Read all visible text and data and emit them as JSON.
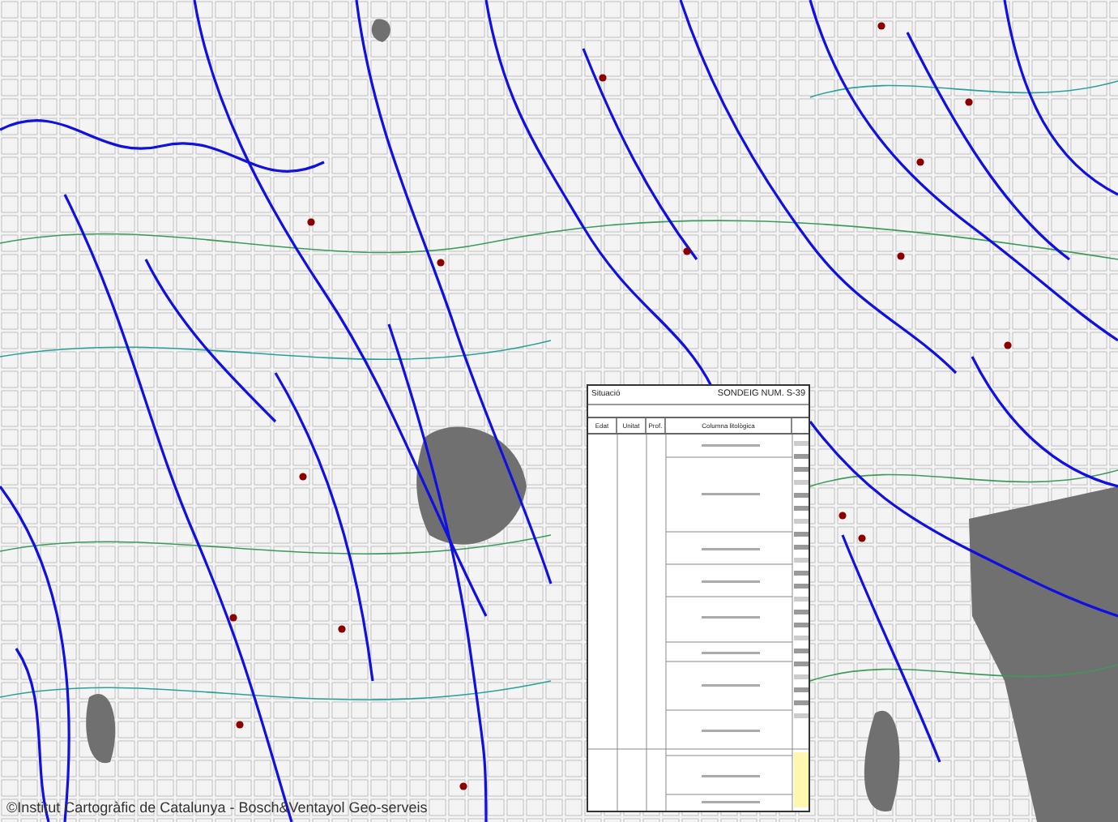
{
  "map": {
    "attribution": "©Institut Cartogràfic de Catalunya - Bosch&Ventayol Geo-serveis"
  },
  "borehole_log": {
    "location_label": "Situació",
    "title": "SONDEIG NUM. S-39",
    "columns": [
      "Edat",
      "Unitat",
      "Prof.",
      "Columna litològica"
    ]
  }
}
